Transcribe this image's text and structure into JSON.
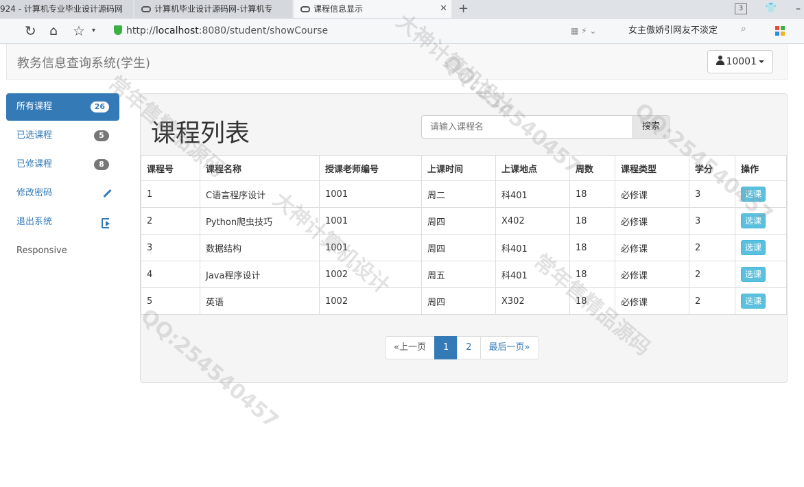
{
  "browser": {
    "tabs": [
      {
        "label": "924 - 计算机专业毕业设计源码网"
      },
      {
        "label": "计算机毕业设计源码网-计算机专"
      },
      {
        "label": "课程信息显示"
      }
    ],
    "tab_count": "3",
    "url_protocol": "http://",
    "url_host": "localhost",
    "url_path": ":8080/student/showCourse",
    "search_text": "女主傲娇引网友不淡定"
  },
  "app": {
    "brand": "教务信息查询系统(学生)",
    "user": "10001"
  },
  "sidebar": {
    "items": [
      {
        "label": "所有课程",
        "badge": "26"
      },
      {
        "label": "已选课程",
        "badge": "5"
      },
      {
        "label": "已修课程",
        "badge": "8"
      },
      {
        "label": "修改密码"
      },
      {
        "label": "退出系统"
      },
      {
        "label": "Responsive"
      }
    ]
  },
  "main": {
    "title": "课程列表",
    "search_placeholder": "请输入课程名",
    "search_button": "搜索",
    "columns": [
      "课程号",
      "课程名称",
      "授课老师编号",
      "上课时间",
      "上课地点",
      "周数",
      "课程类型",
      "学分",
      "操作"
    ],
    "rows": [
      [
        "1",
        "C语言程序设计",
        "1001",
        "周二",
        "科401",
        "18",
        "必修课",
        "3",
        "选课"
      ],
      [
        "2",
        "Python爬虫技巧",
        "1001",
        "周四",
        "X402",
        "18",
        "必修课",
        "3",
        "选课"
      ],
      [
        "3",
        "数据结构",
        "1001",
        "周四",
        "科401",
        "18",
        "必修课",
        "2",
        "选课"
      ],
      [
        "4",
        "Java程序设计",
        "1002",
        "周五",
        "科401",
        "18",
        "必修课",
        "2",
        "选课"
      ],
      [
        "5",
        "英语",
        "1002",
        "周四",
        "X302",
        "18",
        "必修课",
        "2",
        "选课"
      ]
    ],
    "pagination": {
      "prev": "«上一页",
      "pages": [
        "1",
        "2"
      ],
      "last": "最后一页»"
    }
  }
}
